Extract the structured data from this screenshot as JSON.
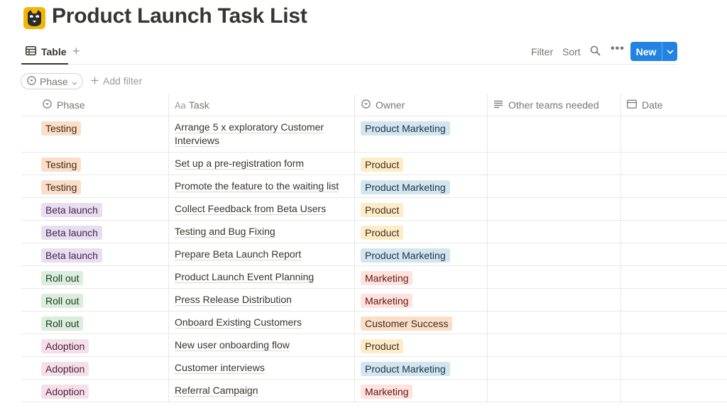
{
  "page": {
    "title": "Product Launch Task List",
    "icon": "cat-face-icon"
  },
  "toolbar": {
    "view_tab": "Table",
    "add_view": "+",
    "filter": "Filter",
    "sort": "Sort",
    "more": "•••",
    "new_label": "New"
  },
  "filters": {
    "phase_pill": "Phase",
    "add_filter": "Add filter"
  },
  "columns": {
    "phase": "Phase",
    "task": "Task",
    "task_prefix": "Aa",
    "owner": "Owner",
    "other_teams": "Other teams needed",
    "date": "Date"
  },
  "colors": {
    "accent": "#2383e2",
    "tags": {
      "Testing": {
        "bg": "#fadec9",
        "fg": "#49290e"
      },
      "Beta launch": {
        "bg": "#e8deee",
        "fg": "#412454"
      },
      "Roll out": {
        "bg": "#dbeddb",
        "fg": "#1c3829"
      },
      "Adoption": {
        "bg": "#f5e0e9",
        "fg": "#4c2337"
      },
      "Product Marketing": {
        "bg": "#d3e5ef",
        "fg": "#183347"
      },
      "Product": {
        "bg": "#fdecc8",
        "fg": "#402c1b"
      },
      "Marketing": {
        "bg": "#ffe2dd",
        "fg": "#5d1715"
      },
      "Customer Success": {
        "bg": "#fadec9",
        "fg": "#49290e"
      }
    }
  },
  "rows": [
    {
      "phase": "Testing",
      "task": "Arrange 5 x exploratory Customer Interviews",
      "owner": "Product Marketing"
    },
    {
      "phase": "Testing",
      "task": "Set up a pre-registration form",
      "owner": "Product"
    },
    {
      "phase": "Testing",
      "task": "Promote the feature to the waiting list",
      "owner": "Product Marketing"
    },
    {
      "phase": "Beta launch",
      "task": "Collect Feedback from Beta Users",
      "owner": "Product"
    },
    {
      "phase": "Beta launch",
      "task": "Testing and Bug Fixing",
      "owner": "Product"
    },
    {
      "phase": "Beta launch",
      "task": "Prepare Beta Launch Report",
      "owner": "Product Marketing"
    },
    {
      "phase": "Roll out",
      "task": "Product Launch Event Planning",
      "owner": "Marketing"
    },
    {
      "phase": "Roll out",
      "task": "Press Release Distribution",
      "owner": "Marketing"
    },
    {
      "phase": "Roll out",
      "task": "Onboard Existing Customers",
      "owner": "Customer Success"
    },
    {
      "phase": "Adoption",
      "task": "New user onboarding flow",
      "owner": "Product"
    },
    {
      "phase": "Adoption",
      "task": "Customer interviews",
      "owner": "Product Marketing"
    },
    {
      "phase": "Adoption",
      "task": "Referral Campaign",
      "owner": "Marketing"
    }
  ]
}
